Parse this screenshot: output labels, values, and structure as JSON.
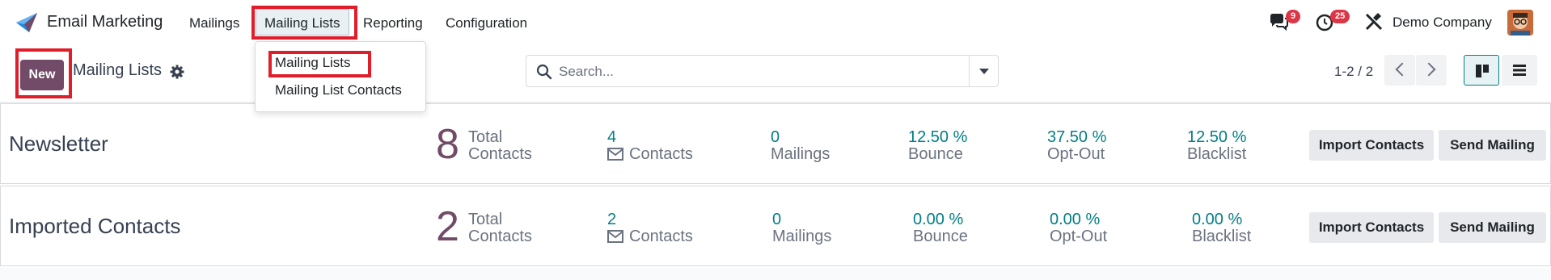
{
  "navbar": {
    "app_name": "Email Marketing",
    "menu": {
      "mailings": "Mailings",
      "mailing_lists": "Mailing Lists",
      "reporting": "Reporting",
      "configuration": "Configuration"
    },
    "messages_count": "9",
    "activities_count": "25",
    "company": "Demo Company"
  },
  "dropdown": {
    "items": [
      "Mailing Lists",
      "Mailing List Contacts"
    ]
  },
  "control_panel": {
    "new_label": "New",
    "title": "Mailing Lists",
    "search_placeholder": "Search...",
    "pager": "1-2 / 2"
  },
  "records": [
    {
      "name": "Newsletter",
      "total": "8",
      "total_label_1": "Total",
      "total_label_2": "Contacts",
      "contacts": "4",
      "contacts_label": "Contacts",
      "mailings": "0",
      "mailings_label": "Mailings",
      "bounce": "12.50 %",
      "bounce_label": "Bounce",
      "optout": "37.50 %",
      "optout_label": "Opt-Out",
      "blacklist": "12.50 %",
      "blacklist_label": "Blacklist",
      "import_label": "Import Contacts",
      "send_label": "Send Mailing"
    },
    {
      "name": "Imported Contacts",
      "total": "2",
      "total_label_1": "Total",
      "total_label_2": "Contacts",
      "contacts": "2",
      "contacts_label": "Contacts",
      "mailings": "0",
      "mailings_label": "Mailings",
      "bounce": "0.00 %",
      "bounce_label": "Bounce",
      "optout": "0.00 %",
      "optout_label": "Opt-Out",
      "blacklist": "0.00 %",
      "blacklist_label": "Blacklist",
      "import_label": "Import Contacts",
      "send_label": "Send Mailing"
    }
  ],
  "colors": {
    "primary": "#714b67",
    "accent": "#017e84",
    "highlight": "#e11d2a",
    "badge": "#dc3545"
  }
}
